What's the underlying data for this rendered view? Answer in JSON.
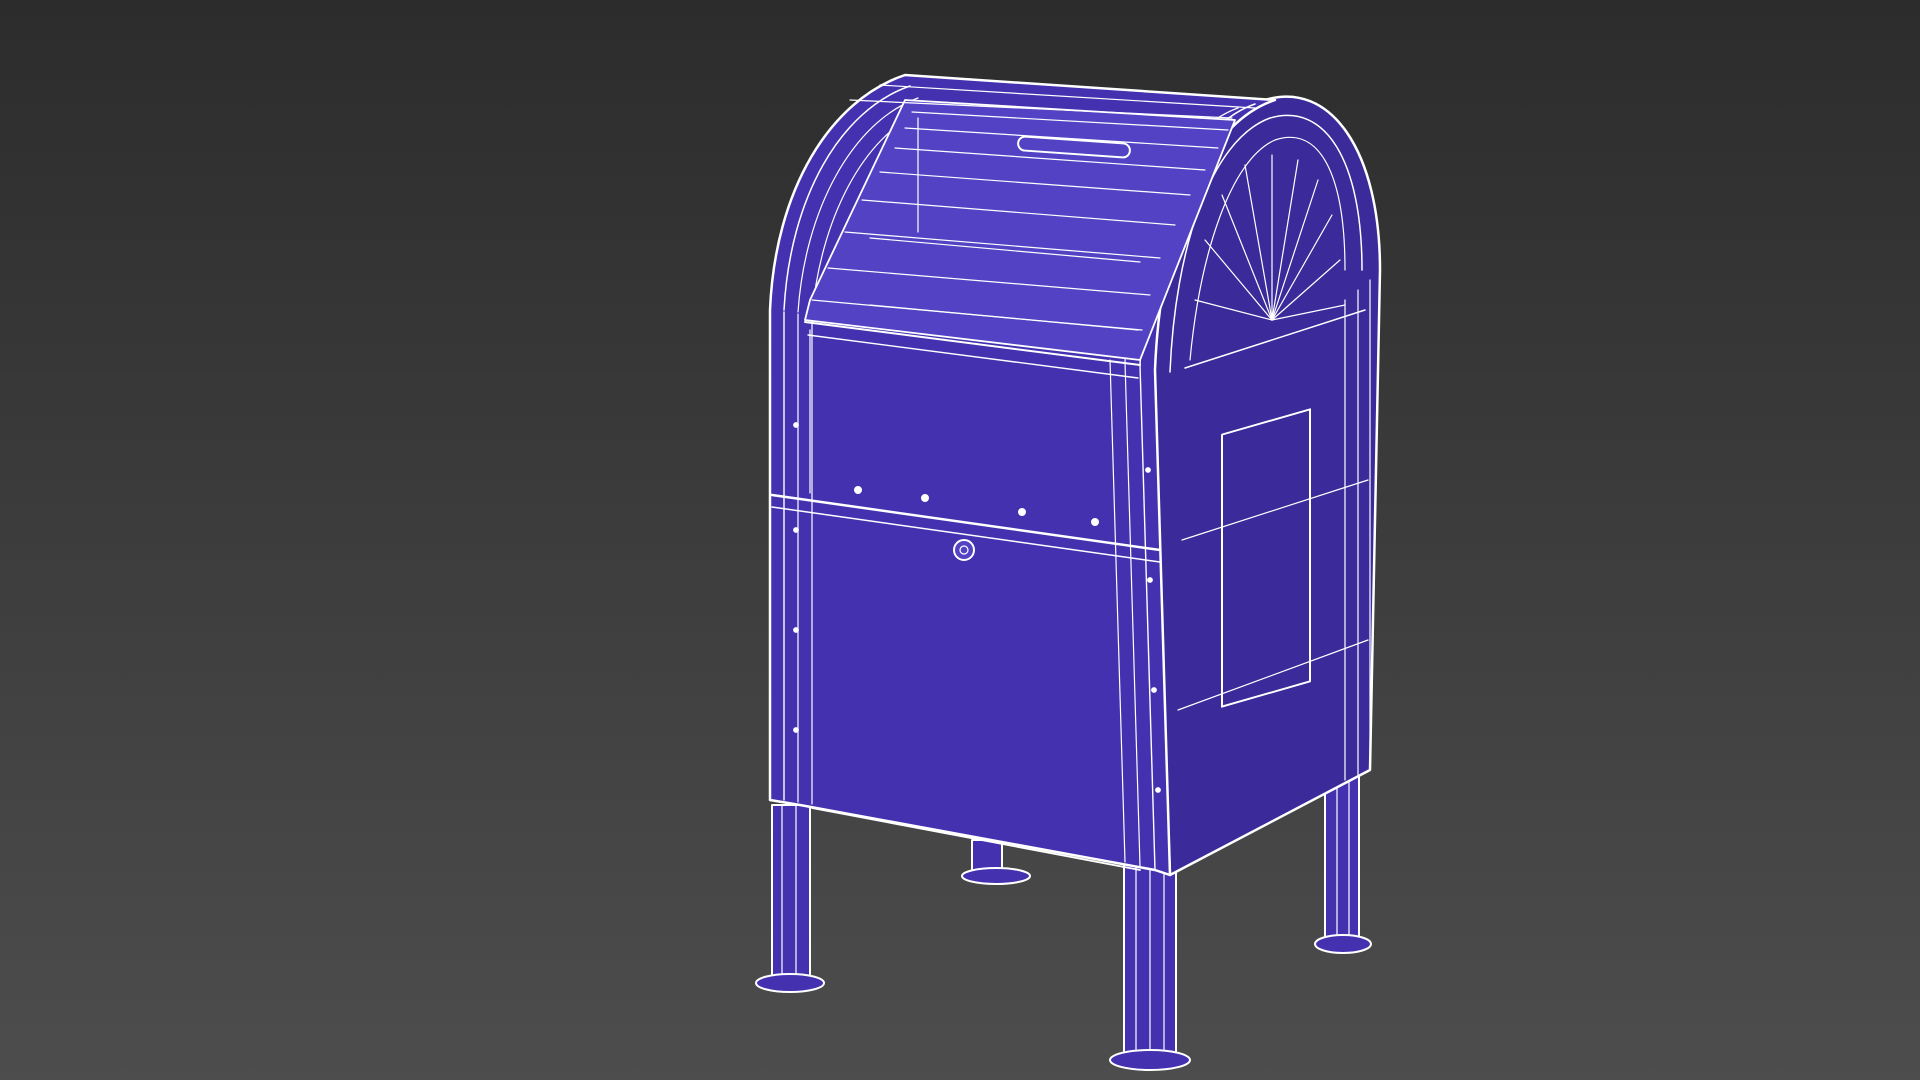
{
  "viewport": {
    "background_top": "#2c2c2c",
    "background_bottom": "#4d4d4d"
  },
  "model": {
    "object": "mailbox",
    "shading": "wireframe-over-shaded",
    "fill_color": "#4431b0",
    "fill_color_light": "#5343c4",
    "fill_color_dark": "#3a2a9a",
    "wire_color": "#ffffff"
  }
}
